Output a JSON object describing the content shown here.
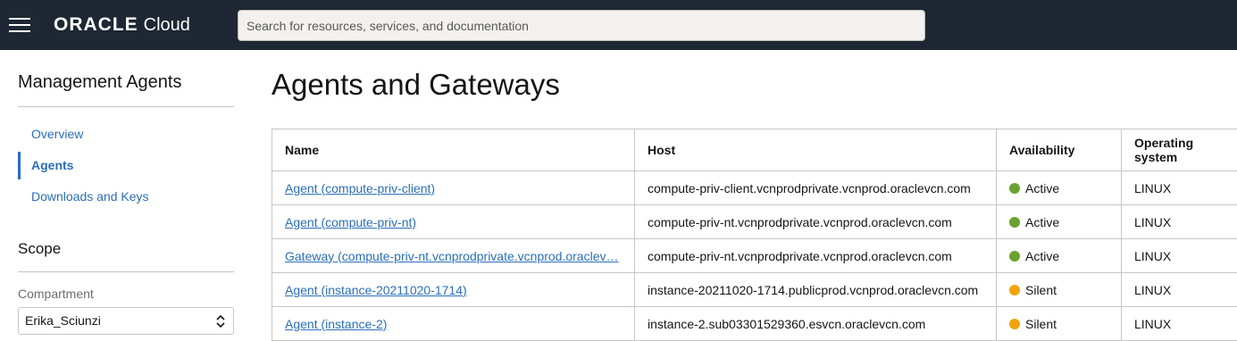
{
  "header": {
    "brand": "ORACLE",
    "product": "Cloud",
    "search_placeholder": "Search for resources, services, and documentation"
  },
  "sidebar": {
    "title": "Management Agents",
    "items": [
      {
        "label": "Overview"
      },
      {
        "label": "Agents"
      },
      {
        "label": "Downloads and Keys"
      }
    ],
    "scope_title": "Scope",
    "compartment_label": "Compartment",
    "compartment_value": "Erika_Sciunzi"
  },
  "main": {
    "title": "Agents and Gateways",
    "columns": [
      "Name",
      "Host",
      "Availability",
      "Operating system"
    ],
    "rows": [
      {
        "name": "Agent (compute-priv-client)",
        "host": "compute-priv-client.vcnprodprivate.vcnprod.oraclevcn.com",
        "availability": "Active",
        "status_color": "#6aa22f",
        "os": "LINUX"
      },
      {
        "name": "Agent (compute-priv-nt)",
        "host": "compute-priv-nt.vcnprodprivate.vcnprod.oraclevcn.com",
        "availability": "Active",
        "status_color": "#6aa22f",
        "os": "LINUX"
      },
      {
        "name": "Gateway (compute-priv-nt.vcnprodprivate.vcnprod.oraclev…",
        "host": "compute-priv-nt.vcnprodprivate.vcnprod.oraclevcn.com",
        "availability": "Active",
        "status_color": "#6aa22f",
        "os": "LINUX"
      },
      {
        "name": "Agent (instance-20211020-1714)",
        "host": "instance-20211020-1714.publicprod.vcnprod.oraclevcn.com",
        "availability": "Silent",
        "status_color": "#f0a30a",
        "os": "LINUX"
      },
      {
        "name": "Agent (instance-2)",
        "host": "instance-2.sub03301529360.esvcn.oraclevcn.com",
        "availability": "Silent",
        "status_color": "#f0a30a",
        "os": "LINUX"
      }
    ]
  }
}
